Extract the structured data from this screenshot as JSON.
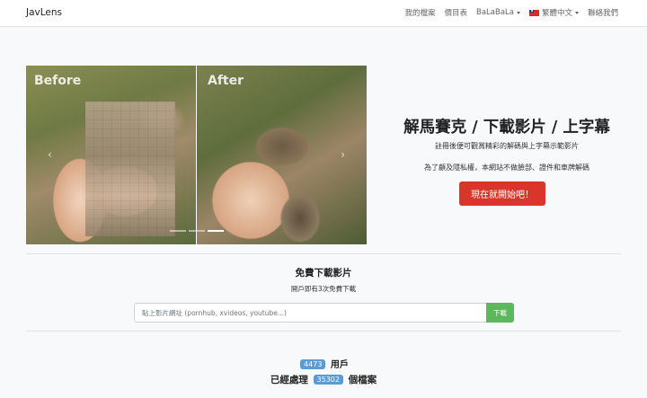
{
  "navbar": {
    "brand": "JavLens",
    "links": {
      "my_files": "我的檔案",
      "pricing": "價目表",
      "balabala": "BaLaBaLa",
      "language": "繁體中文",
      "contact": "聯絡我們"
    },
    "flag_icon": "taiwan-flag-icon"
  },
  "hero": {
    "image_labels": {
      "before": "Before",
      "after": "After"
    },
    "carousel": {
      "prev": "‹",
      "next": "›",
      "indicator_count": 3,
      "active_index": 2
    },
    "title": "解馬賽克 / 下載影片 / 上字幕",
    "subtitle1": "註冊後便可觀賞精彩的解碼與上字幕示範影片",
    "subtitle2": "為了顧及隱私權，本網站不做臉部、證件和車牌解碼",
    "cta_label": "現在就開始吧！"
  },
  "download": {
    "title": "免費下載影片",
    "subtitle": "開戶即有3次免費下載",
    "placeholder": "貼上影片網址 (pornhub, xvideos, youtube...)",
    "button_label": "下載"
  },
  "stats": {
    "users_count": "4473",
    "users_label": "用戶",
    "processed_prefix": "已經處理",
    "files_count": "35302",
    "files_label": "個檔案"
  },
  "colors": {
    "cta": "#d9352b",
    "download_button": "#5cb85c",
    "badge": "#5b9bd5"
  }
}
